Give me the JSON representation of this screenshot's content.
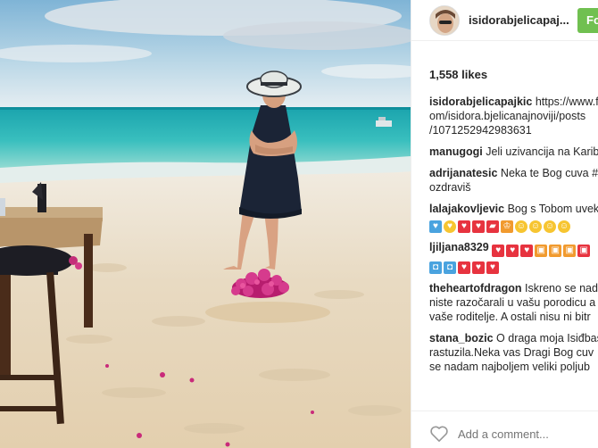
{
  "post": {
    "username": "isidorabjelicapaj...",
    "follow_label": "Fo",
    "likes": "1,558 likes",
    "comments": [
      {
        "user": "isidorabjelicapajkic",
        "lines": [
          "https://www.fa",
          "om/isidora.bjelicanajnoviji/posts",
          "/1071252942983631"
        ]
      },
      {
        "user": "manugogi",
        "lines": [
          "Jeli uzivancija na Karib"
        ]
      },
      {
        "user": "adrijanatesic",
        "lines": [
          "Neka te Bog cuva #",
          "ozdraviš"
        ]
      },
      {
        "user": "lalajakovljevic",
        "lines": [
          "Bog s Tobom uvek"
        ]
      },
      {
        "user": "ljiljana8329",
        "lines": [
          ""
        ]
      },
      {
        "user": "theheartofdragon",
        "lines": [
          "Iskreno se nad",
          "niste razočarali u vašu porodicu a",
          "vaše roditelje. A ostali nisu ni bitr"
        ]
      },
      {
        "user": "stana_bozic",
        "lines": [
          "O draga moja Isiđbas",
          "rastuzila.Neka vas Dragi Bog cuv",
          "se nadam najboljem veliki poljub"
        ]
      }
    ],
    "emoji_rows": [
      [
        "blue-heart",
        "yellow-heart",
        "red-heart",
        "heart-box",
        "car",
        "crown",
        "smile",
        "smile",
        "smile",
        "smile"
      ],
      [
        "bubble",
        "bubble",
        "red-heart",
        "red-heart",
        "red-heart",
        "box",
        "box",
        "box"
      ],
      [
        "cup",
        "cup",
        "red-heart",
        "red-heart",
        "red-heart"
      ]
    ],
    "add_comment_placeholder": "Add a comment..."
  },
  "colors": {
    "follow_green": "#70c050",
    "ocean": "#2fb5b8",
    "sand": "#e9dcc6",
    "sky": "#9ec8e0"
  }
}
